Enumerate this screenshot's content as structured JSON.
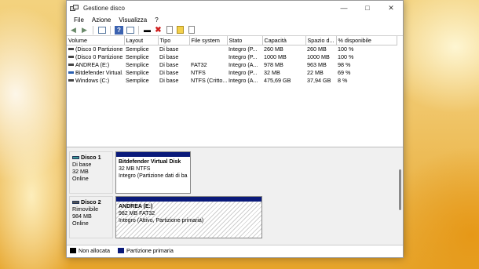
{
  "window": {
    "title": "Gestione disco"
  },
  "menu": [
    "File",
    "Azione",
    "Visualizza",
    "?"
  ],
  "toolbar": {
    "icons": [
      "back-arrow-icon",
      "forward-arrow-icon",
      "list-view-icon",
      "help-icon",
      "properties-icon",
      "connect-disk-icon",
      "delete-icon",
      "check-icon",
      "folder-icon",
      "new-volume-icon"
    ]
  },
  "columns": [
    "Volume",
    "Layout",
    "Tipo",
    "File system",
    "Stato",
    "Capacità",
    "Spazio d...",
    "% disponibile"
  ],
  "volumes": [
    {
      "volume": "(Disco 0 Partizione...",
      "layout": "Semplice",
      "tipo": "Di base",
      "fs": "",
      "stato": "Integro (P...",
      "capacita": "260 MB",
      "spazio": "260 MB",
      "perc": "100 %",
      "icon": "disk"
    },
    {
      "volume": "(Disco 0 Partizione...",
      "layout": "Semplice",
      "tipo": "Di base",
      "fs": "",
      "stato": "Integro (P...",
      "capacita": "1000 MB",
      "spazio": "1000 MB",
      "perc": "100 %",
      "icon": "disk"
    },
    {
      "volume": "ANDREA (E:)",
      "layout": "Semplice",
      "tipo": "Di base",
      "fs": "FAT32",
      "stato": "Integro (A...",
      "capacita": "978 MB",
      "spazio": "963 MB",
      "perc": "98 %",
      "icon": "disk"
    },
    {
      "volume": "Bitdefender Virtual...",
      "layout": "Semplice",
      "tipo": "Di base",
      "fs": "NTFS",
      "stato": "Integro (P...",
      "capacita": "32 MB",
      "spazio": "22 MB",
      "perc": "69 %",
      "icon": "blue"
    },
    {
      "volume": "Windows (C:)",
      "layout": "Semplice",
      "tipo": "Di base",
      "fs": "NTFS (Critto...",
      "stato": "Integro (A...",
      "capacita": "475,69 GB",
      "spazio": "37,94 GB",
      "perc": "8 %",
      "icon": "disk"
    }
  ],
  "disks": [
    {
      "name": "Disco 1",
      "type": "Di base",
      "size": "32 MB",
      "status": "Online",
      "partition": {
        "name": "Bitdefender Virtual Disk",
        "detail": "32 MB NTFS",
        "state": "Integro (Partizione dati di ba"
      }
    },
    {
      "name": "Disco 2",
      "type": "Rimovibile",
      "size": "984 MB",
      "status": "Online",
      "partition": {
        "name": "ANDREA  (E:)",
        "detail": "982 MB FAT32",
        "state": "Integro (Attivo, Partizione primaria)"
      }
    }
  ],
  "legend": {
    "unallocated": "Non allocata",
    "primary": "Partizione primaria"
  },
  "colors": {
    "partition_bar": "#0a1a7a",
    "unallocated": "#000000"
  }
}
